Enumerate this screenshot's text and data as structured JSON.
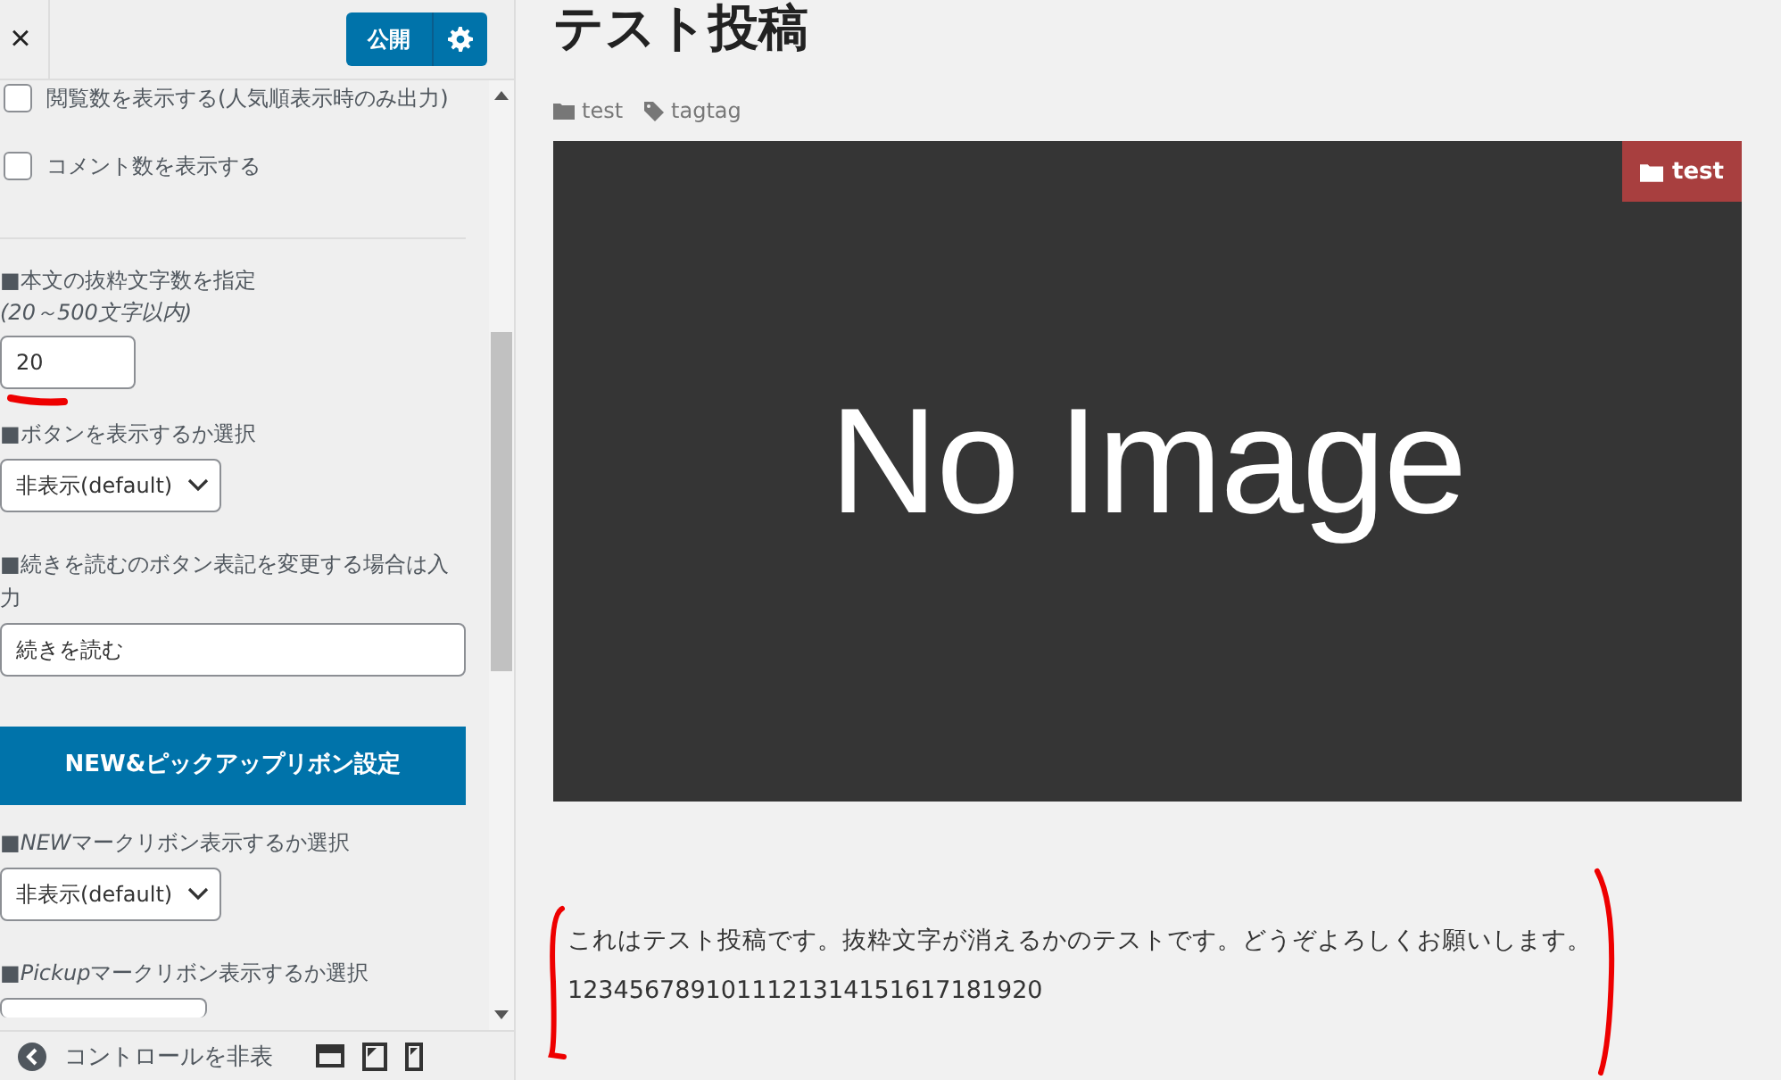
{
  "header": {
    "close": "×",
    "publish": "公開"
  },
  "sidebar": {
    "items": [
      {
        "kind": "checkbox",
        "label": "閲覧数を表示する(人気順表示時のみ出力)",
        "checked": false
      },
      {
        "kind": "checkbox",
        "label": "コメント数を表示する",
        "checked": false
      },
      {
        "kind": "number",
        "label": "■本文の抜粋文字数を指定",
        "hint": "(20～500文字以内)",
        "value": "20",
        "underlined": true
      },
      {
        "kind": "select",
        "label": "■ボタンを表示するか選択",
        "value": "非表示(default)"
      },
      {
        "kind": "text",
        "label": "■続きを読むのボタン表記を変更する場合は入力",
        "value": "続きを読む"
      },
      {
        "kind": "heading",
        "label": "NEW&ピックアップリボン設定"
      },
      {
        "kind": "select",
        "mark": "■",
        "italic": "NEW",
        "label": "マークリボン表示するか選択",
        "value": "非表示(default)"
      },
      {
        "kind": "select",
        "mark": "■",
        "italic": "Pickup",
        "label": "マークリボン表示するか選択"
      }
    ]
  },
  "footer": {
    "label": "コントロールを非表"
  },
  "post": {
    "title": "テスト投稿",
    "category": "test",
    "tag": "tagtag",
    "image_text": "No Image",
    "badge": "test",
    "lines": [
      "これはテスト投稿です。抜粋文字が消えるかのテストです。どうぞよろしくお願いします。",
      "1234567891011121314151617181920"
    ]
  }
}
